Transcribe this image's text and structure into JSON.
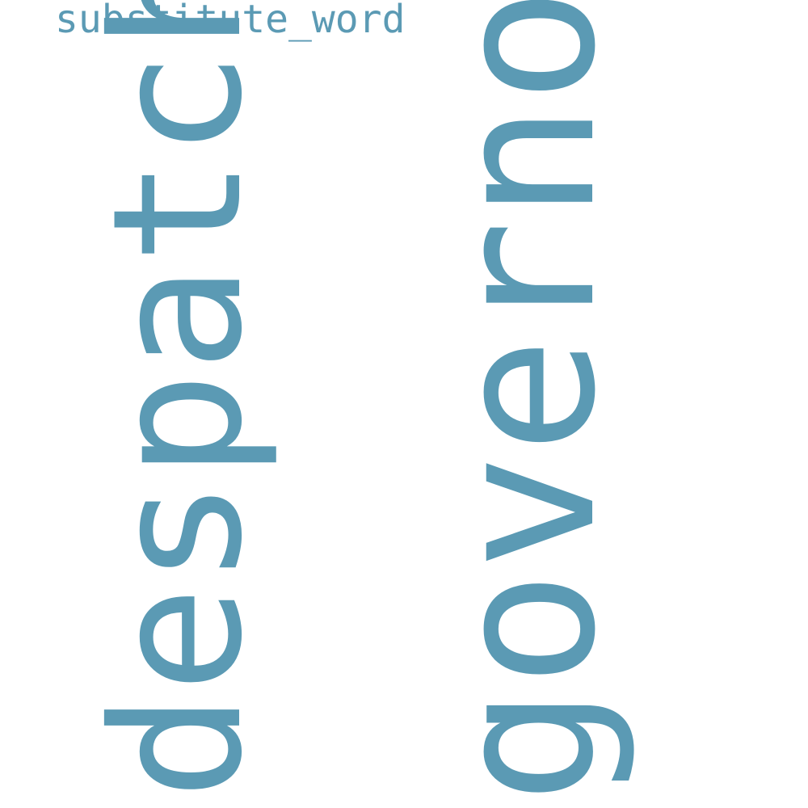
{
  "colors": {
    "background": "#ffffff",
    "word": "#5b9ab4"
  },
  "words": {
    "substitute_word": "substitute_word",
    "despatch": "despatch",
    "governor": "governor"
  }
}
